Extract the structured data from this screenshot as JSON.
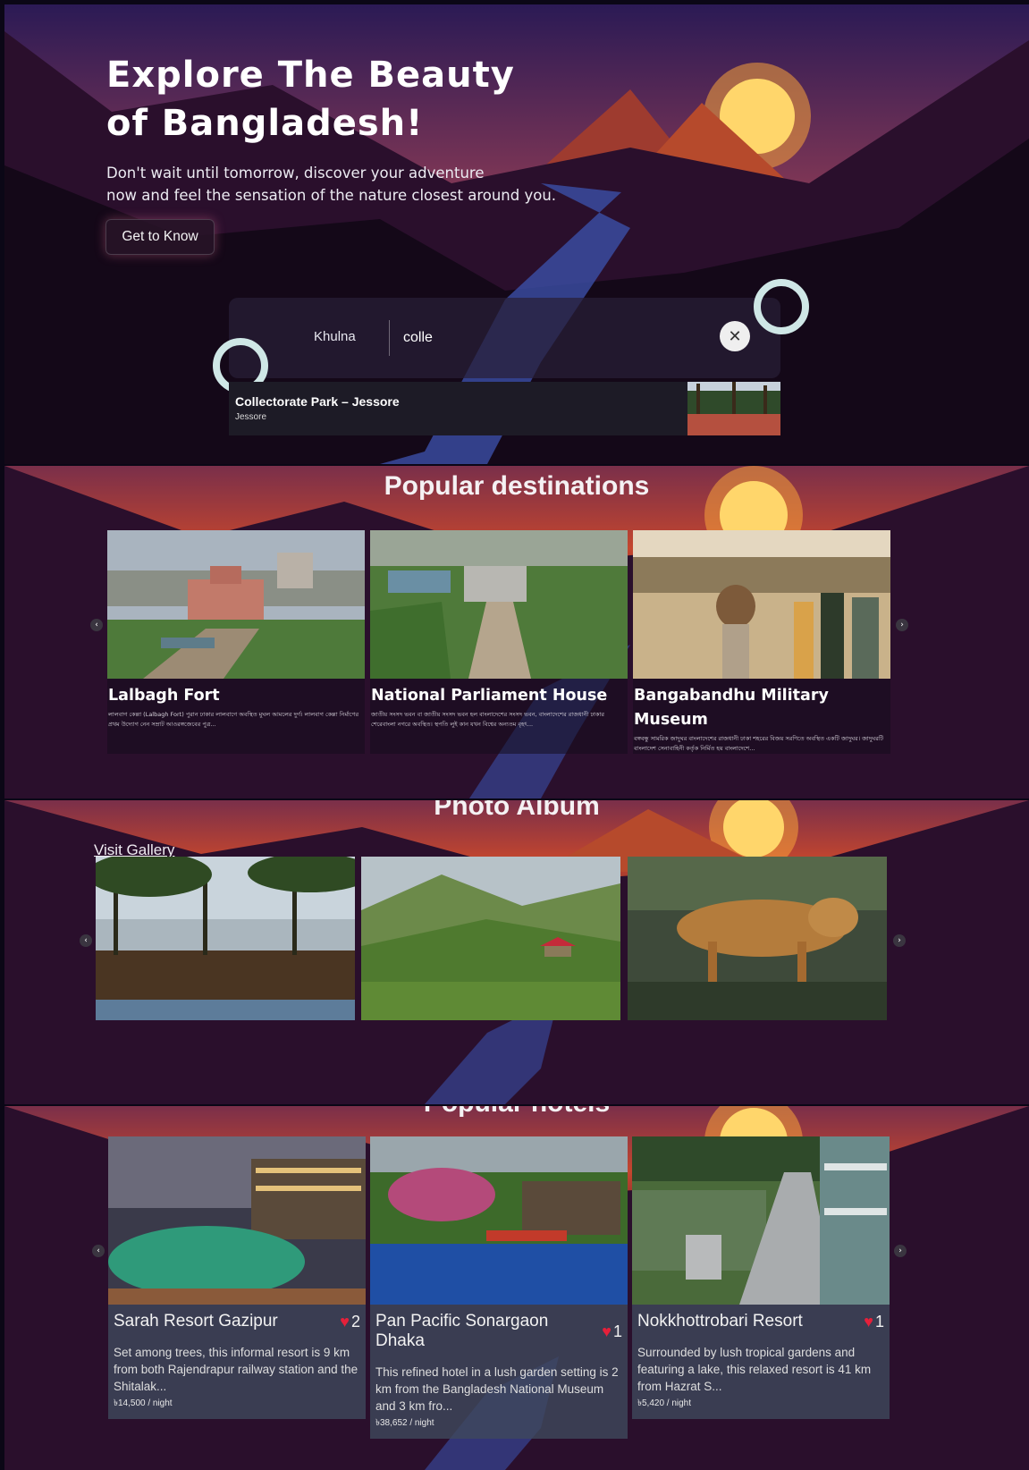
{
  "hero": {
    "title_line1": "Explore The Beauty",
    "title_line2": "of Bangladesh!",
    "subtitle_line1": "Don't wait until tomorrow, discover your adventure",
    "subtitle_line2": "now and feel the sensation of the nature closest around you.",
    "cta_label": "Get to Know"
  },
  "search": {
    "city": "Khulna",
    "query": "colle",
    "clear_icon": "close-icon",
    "suggestion": {
      "title": "Collectorate Park – Jessore",
      "subtitle": "Jessore"
    }
  },
  "popular_destinations": {
    "title": "Popular destinations",
    "items": [
      {
        "name": "Lalbagh Fort",
        "description": "লালবাগ কেল্লা (Lalbagh Fort) পুরান ঢাকার লালবাগে অবস্থিত মুঘল আমলের দুর্গ। লালবাগ কেল্লা নির্মাণের প্রথম উদ্যোগ নেন সম্রাট আওরঙ্গজেবের পুত্র..."
      },
      {
        "name": "National Parliament House",
        "description": "জাতীয় সংসদ ভবন বা জাতীয় সংসদ ভবন হল বাংলাদেশের সংসদ ভবন, বাংলাদেশের রাজধানী ঢাকার শেরেবাংলা নগরে অবস্থিত। স্থপতি লুই কান যখন বিশ্বের অন্যতম বৃহৎ..."
      },
      {
        "name": "Bangabandhu Military Museum",
        "description": "বঙ্গবন্ধু সামরিক জাদুঘর বাংলাদেশের রাজধানী ঢাকা শহরের বিজয় সরণিতে অবস্থিত একটি জাদুঘর। জাদুঘরটি বাংলাদেশ সেনাবাহিনী কর্তৃক নির্মিত হয় বাংলাদেশে..."
      }
    ]
  },
  "photo_album": {
    "title": "Photo Album",
    "gallery_link": "Visit Gallery"
  },
  "popular_hotels": {
    "title": "Popular hotels",
    "items": [
      {
        "name": "Sarah Resort Gazipur",
        "likes": "2",
        "description": "Set among trees, this informal resort is 9 km from both Rajendrapur railway station and the Shitalak...",
        "price": "৳14,500 / night"
      },
      {
        "name": "Pan Pacific Sonargaon Dhaka",
        "likes": "1",
        "description": "This refined hotel in a lush garden setting is 2 km from the Bangladesh National Museum and 3 km fro...",
        "price": "৳38,652 / night"
      },
      {
        "name": "Nokkhottrobari Resort",
        "likes": "1",
        "description": "Surrounded by lush tropical gardens and featuring a lake, this relaxed resort is 41 km from Hazrat S...",
        "price": "৳5,420 / night"
      }
    ]
  },
  "colors": {
    "accent_heart": "#e5203a",
    "sun": "#ffd66b",
    "sky_top": "#2b1a55",
    "sky_bottom": "#c4462e"
  }
}
